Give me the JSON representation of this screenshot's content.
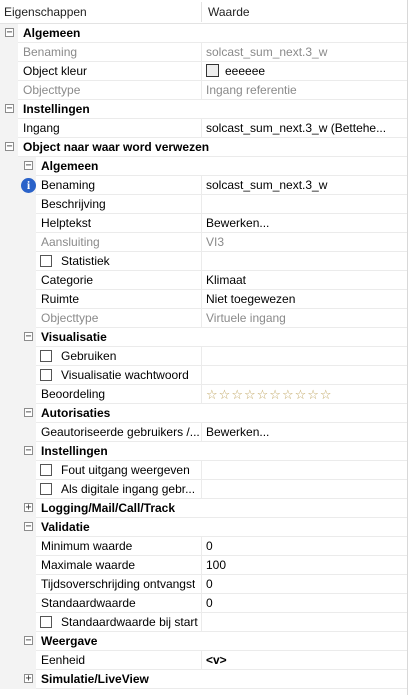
{
  "header": {
    "col1": "Eigenschappen",
    "col2": "Waarde"
  },
  "rows": [
    {
      "type": "cat",
      "level": 0,
      "expander": "-",
      "label": "Algemeen"
    },
    {
      "type": "prop",
      "level": 0,
      "label": "Benaming",
      "value": "solcast_sum_next.3_w",
      "readonly": true
    },
    {
      "type": "prop",
      "level": 0,
      "label": "Object kleur",
      "value": "eeeeee",
      "swatch": "#eeeeee"
    },
    {
      "type": "prop",
      "level": 0,
      "label": "Objecttype",
      "value": "Ingang referentie",
      "readonly": true
    },
    {
      "type": "cat",
      "level": 0,
      "expander": "-",
      "label": "Instellingen"
    },
    {
      "type": "prop",
      "level": 0,
      "label": "Ingang",
      "value": "solcast_sum_next.3_w (Bettehe..."
    },
    {
      "type": "cat",
      "level": 0,
      "expander": "-",
      "label": "Object naar waar word verwezen"
    },
    {
      "type": "cat",
      "level": 1,
      "expander": "-",
      "label": "Algemeen"
    },
    {
      "type": "prop",
      "level": 1,
      "label": "Benaming",
      "value": "solcast_sum_next.3_w",
      "info": true
    },
    {
      "type": "prop",
      "level": 1,
      "label": "Beschrijving",
      "value": ""
    },
    {
      "type": "prop",
      "level": 1,
      "label": "Helptekst",
      "value": "Bewerken..."
    },
    {
      "type": "prop",
      "level": 1,
      "label": "Aansluiting",
      "value": "VI3",
      "readonly": true
    },
    {
      "type": "prop",
      "level": 1,
      "label": "Statistiek",
      "value": "",
      "checkbox": true
    },
    {
      "type": "prop",
      "level": 1,
      "label": "Categorie",
      "value": "Klimaat"
    },
    {
      "type": "prop",
      "level": 1,
      "label": "Ruimte",
      "value": "Niet toegewezen"
    },
    {
      "type": "prop",
      "level": 1,
      "label": "Objecttype",
      "value": "Virtuele ingang",
      "readonly": true
    },
    {
      "type": "cat",
      "level": 1,
      "expander": "-",
      "label": "Visualisatie"
    },
    {
      "type": "prop",
      "level": 1,
      "label": "Gebruiken",
      "value": "",
      "checkbox": true
    },
    {
      "type": "prop",
      "level": 1,
      "label": "Visualisatie wachtwoord",
      "value": "",
      "checkbox": true
    },
    {
      "type": "prop",
      "level": 1,
      "label": "Beoordeling",
      "value": "",
      "stars": 10
    },
    {
      "type": "cat",
      "level": 1,
      "expander": "-",
      "label": "Autorisaties"
    },
    {
      "type": "prop",
      "level": 1,
      "label": "Geautoriseerde gebruikers /...",
      "value": "Bewerken..."
    },
    {
      "type": "cat",
      "level": 1,
      "expander": "-",
      "label": "Instellingen"
    },
    {
      "type": "prop",
      "level": 1,
      "label": "Fout uitgang weergeven",
      "value": "",
      "checkbox": true
    },
    {
      "type": "prop",
      "level": 1,
      "label": "Als digitale ingang gebr...",
      "value": "",
      "checkbox": true
    },
    {
      "type": "cat",
      "level": 1,
      "expander": "+",
      "label": "Logging/Mail/Call/Track"
    },
    {
      "type": "cat",
      "level": 1,
      "expander": "-",
      "label": "Validatie"
    },
    {
      "type": "prop",
      "level": 1,
      "label": "Minimum waarde",
      "value": "0"
    },
    {
      "type": "prop",
      "level": 1,
      "label": "Maximale waarde",
      "value": "100"
    },
    {
      "type": "prop",
      "level": 1,
      "label": "Tijdsoverschrijding ontvangst",
      "value": "0"
    },
    {
      "type": "prop",
      "level": 1,
      "label": "Standaardwaarde",
      "value": "0"
    },
    {
      "type": "prop",
      "level": 1,
      "label": "Standaardwaarde bij start",
      "value": "",
      "checkbox": true
    },
    {
      "type": "cat",
      "level": 1,
      "expander": "-",
      "label": "Weergave"
    },
    {
      "type": "prop",
      "level": 1,
      "label": "Eenheid",
      "value": "<v>",
      "boldvalue": true
    },
    {
      "type": "cat",
      "level": 1,
      "expander": "+",
      "label": "Simulatie/LiveView"
    }
  ]
}
